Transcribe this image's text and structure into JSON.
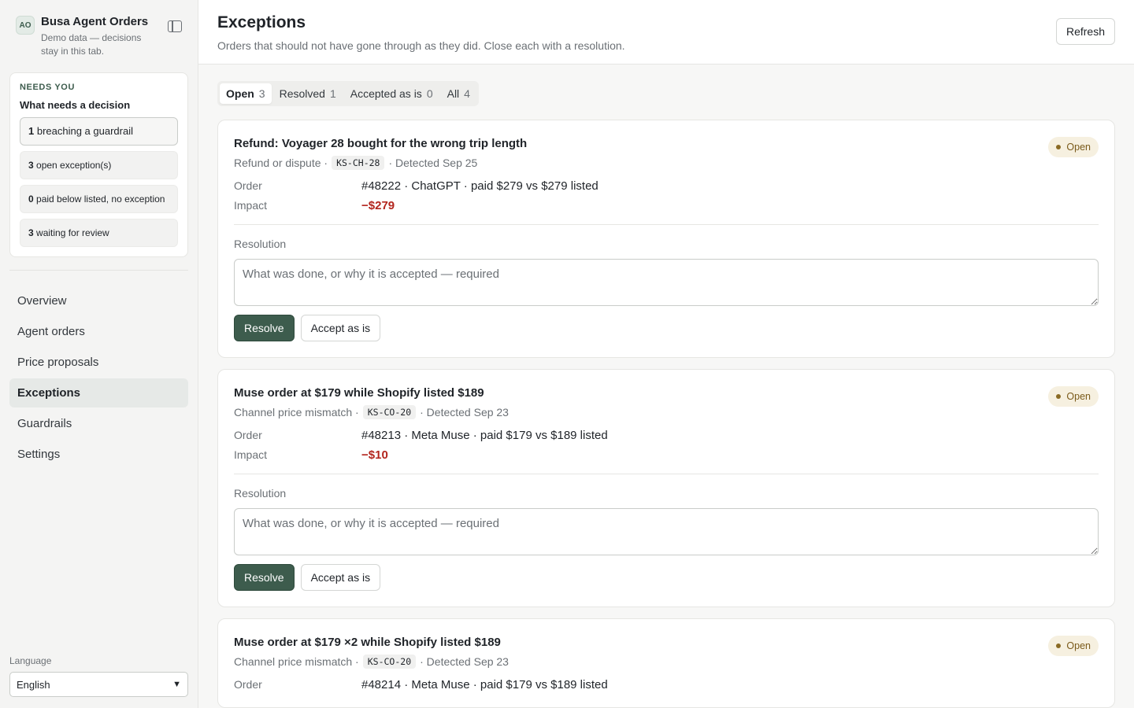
{
  "sidebar": {
    "brand": {
      "avatar": "AO",
      "name": "Busa Agent Orders",
      "subtitle": "Demo data — decisions stay in this tab."
    },
    "needs": {
      "eyebrow": "NEEDS YOU",
      "title": "What needs a decision",
      "items": [
        {
          "count": "1",
          "label": " breaching a guardrail"
        },
        {
          "count": "3",
          "label": " open exception(s)"
        },
        {
          "count": "0",
          "label": " paid below listed, no exception"
        },
        {
          "count": "3",
          "label": " waiting for review"
        }
      ]
    },
    "nav": [
      {
        "label": "Overview"
      },
      {
        "label": "Agent orders"
      },
      {
        "label": "Price proposals"
      },
      {
        "label": "Exceptions"
      },
      {
        "label": "Guardrails"
      },
      {
        "label": "Settings"
      }
    ],
    "language": {
      "label": "Language",
      "value": "English"
    }
  },
  "header": {
    "title": "Exceptions",
    "subtitle": "Orders that should not have gone through as they did. Close each with a resolution.",
    "refresh_label": "Refresh"
  },
  "tabs": [
    {
      "label": "Open",
      "count": "3"
    },
    {
      "label": "Resolved",
      "count": "1"
    },
    {
      "label": "Accepted as is",
      "count": "0"
    },
    {
      "label": "All",
      "count": "4"
    }
  ],
  "labels": {
    "order": "Order",
    "impact": "Impact",
    "resolution": "Resolution",
    "resolution_placeholder": "What was done, or why it is accepted — required",
    "resolve": "Resolve",
    "accept": "Accept as is"
  },
  "exceptions": [
    {
      "title": "Refund: Voyager 28 bought for the wrong trip length",
      "type": "Refund or dispute ·",
      "code": "KS-CH-28",
      "detected": "· Detected Sep 25",
      "status": "Open",
      "order": "#48222 · ChatGPT · paid $279 vs $279 listed",
      "impact": "−$279"
    },
    {
      "title": "Muse order at $179 while Shopify listed $189",
      "type": "Channel price mismatch ·",
      "code": "KS-CO-20",
      "detected": "· Detected Sep 23",
      "status": "Open",
      "order": "#48213 · Meta Muse · paid $179 vs $189 listed",
      "impact": "−$10"
    },
    {
      "title": "Muse order at $179 ×2 while Shopify listed $189",
      "type": "Channel price mismatch ·",
      "code": "KS-CO-20",
      "detected": "· Detected Sep 23",
      "status": "Open",
      "order": "#48214 · Meta Muse · paid $179 vs $189 listed",
      "impact": ""
    }
  ],
  "colors": {
    "accent": "#3d5c4d",
    "impact": "#b3261e",
    "badge_bg": "#f6f0e0",
    "badge_text": "#7a5a1a"
  }
}
